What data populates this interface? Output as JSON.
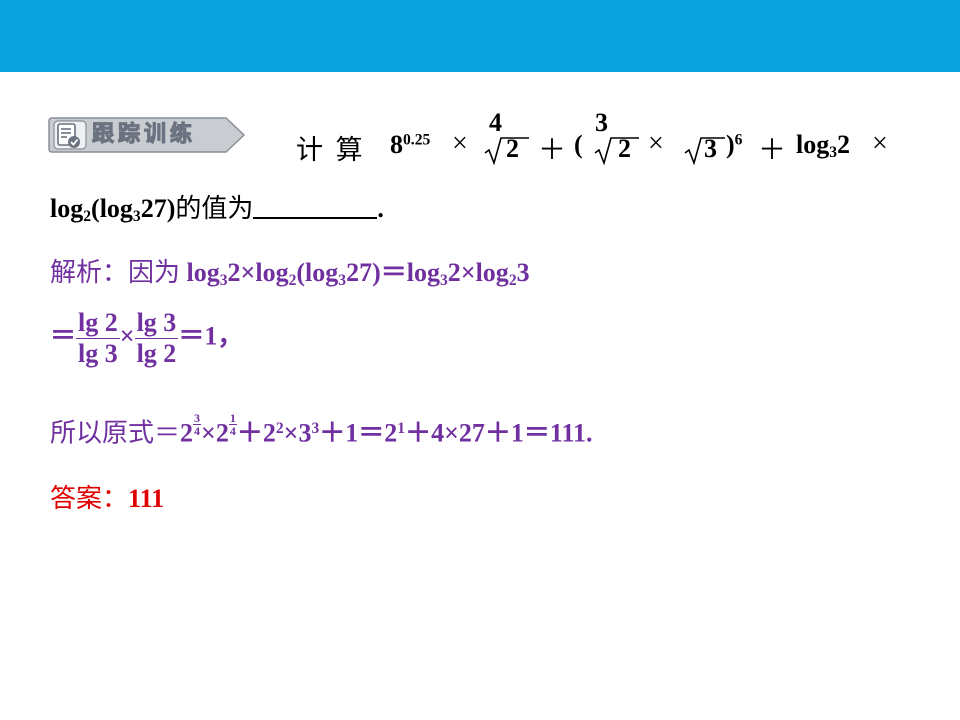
{
  "header": {
    "accent_color": "#0aa3e0"
  },
  "badge": {
    "label": "跟踪训练",
    "icon": "checklist-icon"
  },
  "question": {
    "calc_label": "计 算",
    "base": "8",
    "base_exp": "0.25",
    "times": "×",
    "root4_index": "4",
    "root4_value": "2",
    "plus": "＋",
    "lparen": "(",
    "root3_index": "3",
    "root3_value": "2",
    "sqrt_value": "3",
    "rparen": ")",
    "power": "6",
    "log_base3": "log",
    "log_base3_sub": "3",
    "log_base3_arg": "2",
    "line2_log2": "log",
    "line2_log2_sub": "2",
    "line2_paren_open": "(log",
    "line2_sub3": "3",
    "line2_arg": "27)",
    "line2_tail": "的值为",
    "line2_end": "."
  },
  "analysis": {
    "label": "解析：因为",
    "line1_expr_a": "log",
    "line1_sub_a": "3",
    "line1_arg_a": "2×log",
    "line1_sub_b": "2",
    "line1_arg_b": "(log",
    "line1_sub_c": "3",
    "line1_arg_c": "27)＝log",
    "line1_sub_d": "3",
    "line1_arg_d": "2×log",
    "line1_sub_e": "2",
    "line1_arg_e": "3",
    "line2_eq": "＝",
    "frac1_num": "lg 2",
    "frac1_den": "lg 3",
    "line2_times": "×",
    "frac2_num": "lg 3",
    "frac2_den": "lg 2",
    "line2_result": "＝1，",
    "line3_label": "所以原式＝",
    "line3_b1": "2",
    "line3_e1_num": "3",
    "line3_e1_den": "4",
    "line3_t1": "×",
    "line3_b2": "2",
    "line3_e2_num": "1",
    "line3_e2_den": "4",
    "line3_t2": "＋2",
    "line3_e3": "2",
    "line3_t3": "×3",
    "line3_e4": "3",
    "line3_t4": "＋1＝2",
    "line3_e5": "1",
    "line3_t5": "＋4×27＋1＝111."
  },
  "answer": {
    "label": "答案：",
    "value": "111"
  }
}
